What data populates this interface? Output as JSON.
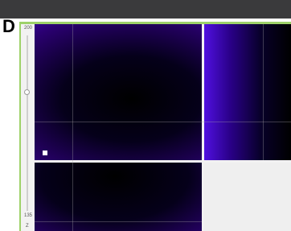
{
  "panel": {
    "letter": "D"
  },
  "slider": {
    "top_value": "200",
    "bottom_value": "135",
    "axis_label": "Z"
  }
}
